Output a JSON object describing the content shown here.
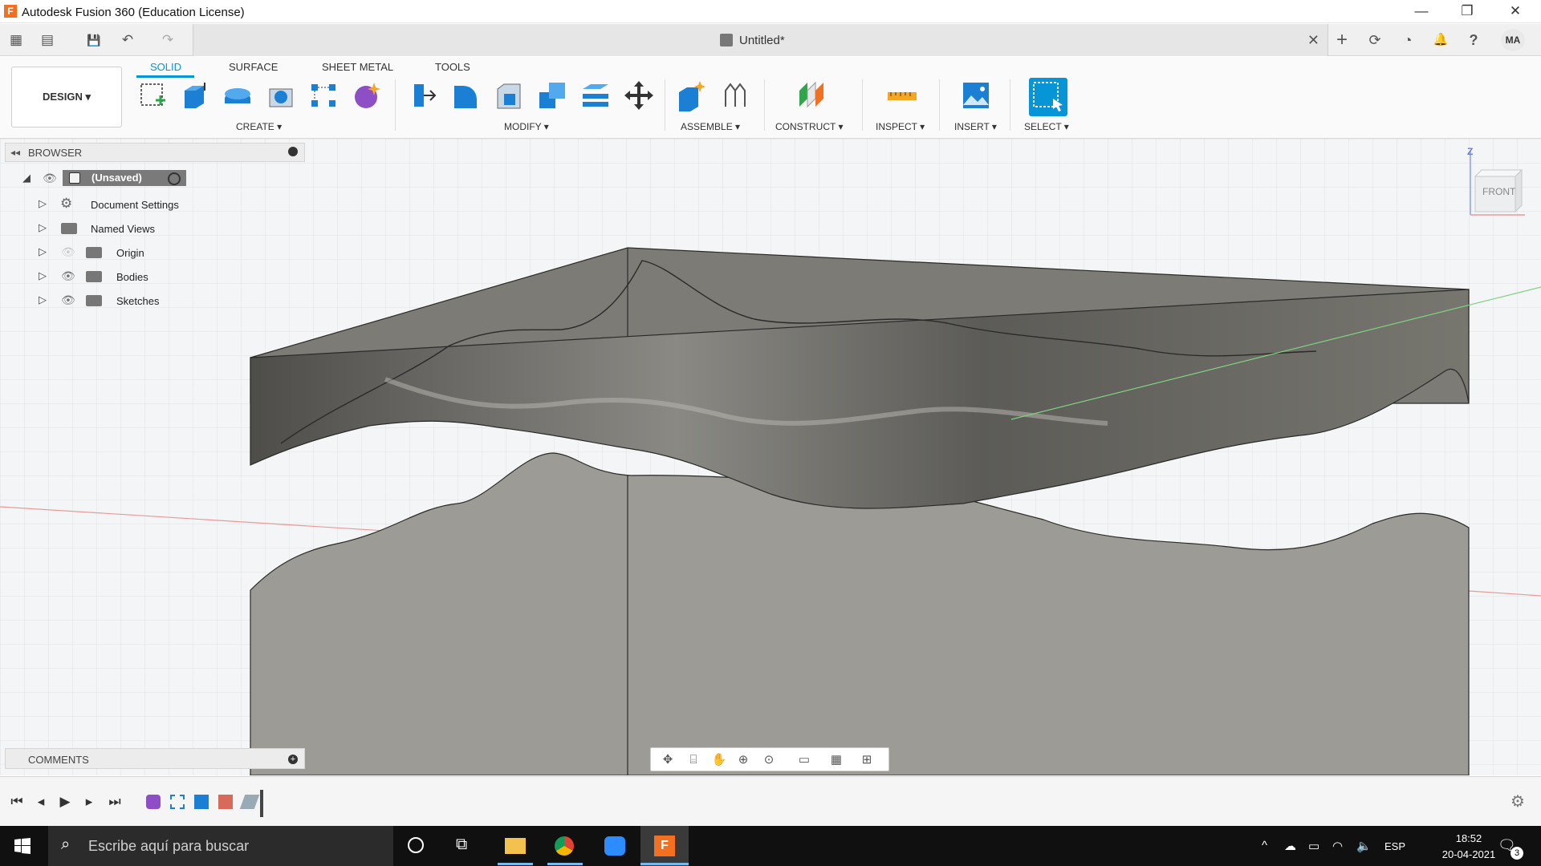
{
  "window": {
    "app_letter": "F",
    "title": "Autodesk Fusion 360 (Education License)",
    "minimize": "—",
    "maximize": "❐",
    "close": "✕"
  },
  "appbar": {
    "grid_icon": "▦",
    "file_icon": "▤",
    "save_icon": "💾",
    "undo_icon": "↶",
    "redo_icon": "↷"
  },
  "document": {
    "title": "Untitled*",
    "close": "✕"
  },
  "right_buttons": {
    "new_tab": "+",
    "extensions": "⟳",
    "job_status": "◔",
    "notifications": "🔔",
    "help": "?",
    "avatar": "MA"
  },
  "toolbar": {
    "workspace": "DESIGN ▾",
    "tabs": [
      "SOLID",
      "SURFACE",
      "SHEET METAL",
      "TOOLS"
    ],
    "groups": {
      "create": "CREATE ▾",
      "modify": "MODIFY ▾",
      "assemble": "ASSEMBLE ▾",
      "construct": "CONSTRUCT ▾",
      "inspect": "INSPECT ▾",
      "insert": "INSERT ▾",
      "select": "SELECT ▾"
    }
  },
  "browser": {
    "label": "BROWSER",
    "root": "(Unsaved)",
    "items": [
      "Document Settings",
      "Named Views",
      "Origin",
      "Bodies",
      "Sketches"
    ]
  },
  "comments": {
    "label": "COMMENTS"
  },
  "viewcube": {
    "face": "FRONT",
    "z_label": "Z"
  },
  "taskbar": {
    "search_placeholder": "Escribe aquí para buscar",
    "language": "ESP",
    "time": "18:52",
    "date": "20-04-2021",
    "notifications_count": "3"
  },
  "colors": {
    "accent": "#0696d7",
    "body_dark": "#5f5e5a",
    "body_light": "#a4a39d"
  }
}
